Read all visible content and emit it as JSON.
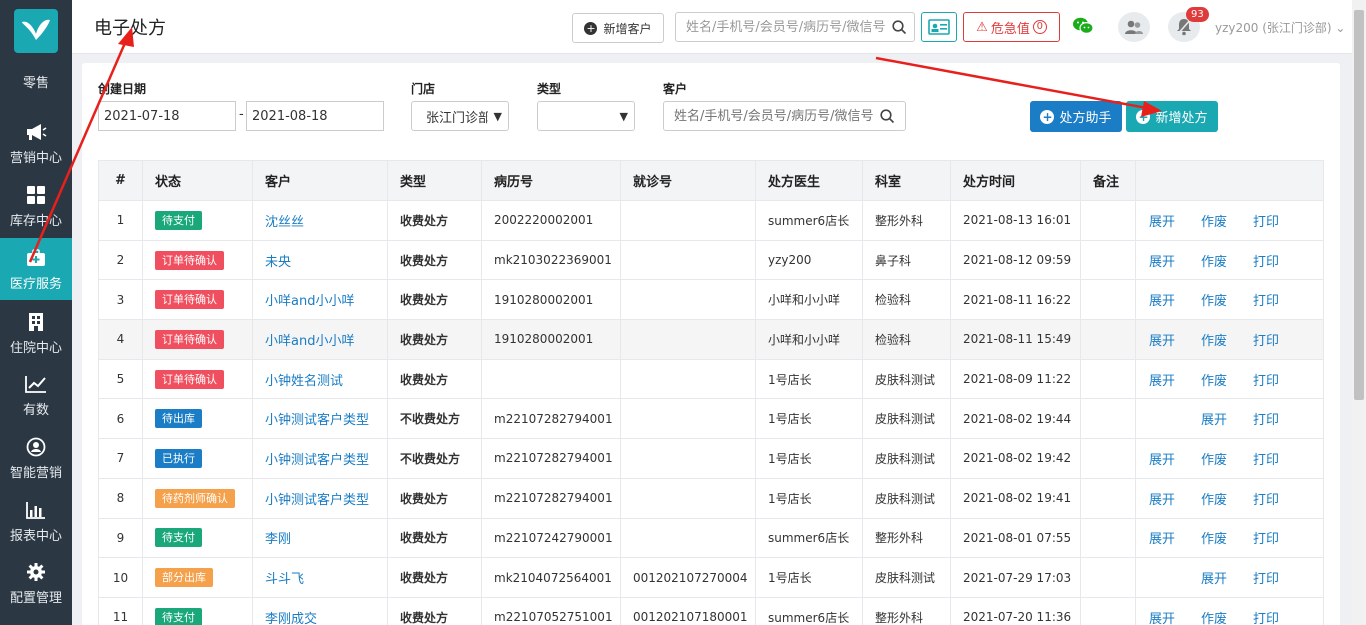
{
  "sidebar": {
    "items": [
      {
        "label": "零售",
        "icon": "retail-icon"
      },
      {
        "label": "营销中心",
        "icon": "megaphone-icon"
      },
      {
        "label": "库存中心",
        "icon": "grid-icon"
      },
      {
        "label": "医疗服务",
        "icon": "medical-kit-icon",
        "active": true
      },
      {
        "label": "住院中心",
        "icon": "building-icon"
      },
      {
        "label": "有数",
        "icon": "trend-icon"
      },
      {
        "label": "智能营销",
        "icon": "ai-icon"
      },
      {
        "label": "报表中心",
        "icon": "bar-chart-icon"
      },
      {
        "label": "配置管理",
        "icon": "gear-icon"
      }
    ]
  },
  "header": {
    "title": "电子处方",
    "new_customer": "新增客户",
    "search_placeholder": "姓名/手机号/会员号/病历号/微信号",
    "urgent_label": "危急值",
    "urgent_count": "0",
    "notify_count": "93",
    "user": "yzy200 (张江门诊部)"
  },
  "filters": {
    "date_label": "创建日期",
    "date_from": "2021-07-18",
    "date_sep": "-",
    "date_to": "2021-08-18",
    "store_label": "门店",
    "store_value": "张江门诊部",
    "type_label": "类型",
    "type_value": "",
    "customer_label": "客户",
    "customer_placeholder": "姓名/手机号/会员号/病历号/微信号",
    "assistant_button": "处方助手",
    "new_rx_button": "新增处方"
  },
  "table": {
    "headers": [
      "#",
      "状态",
      "客户",
      "类型",
      "病历号",
      "就诊号",
      "处方医生",
      "科室",
      "处方时间",
      "备注"
    ],
    "rows": [
      {
        "idx": "1",
        "status": "待支付",
        "status_color": "#1aa87a",
        "customer": "沈丝丝",
        "type": "收费处方",
        "record": "2002220002001",
        "visit": "",
        "doctor": "summer6店长",
        "dept": "整形外科",
        "time": "2021-08-13 16:01",
        "note": "",
        "actions": [
          "展开",
          "作废",
          "打印"
        ]
      },
      {
        "idx": "2",
        "status": "订单待确认",
        "status_color": "#ef4f5f",
        "customer": "未央",
        "type": "收费处方",
        "record": "mk2103022369001",
        "visit": "",
        "doctor": "yzy200",
        "dept": "鼻子科",
        "time": "2021-08-12 09:59",
        "note": "",
        "actions": [
          "展开",
          "作废",
          "打印"
        ]
      },
      {
        "idx": "3",
        "status": "订单待确认",
        "status_color": "#ef4f5f",
        "customer": "小咩and小小咩",
        "type": "收费处方",
        "record": "1910280002001",
        "visit": "",
        "doctor": "小咩和小小咩",
        "dept": "检验科",
        "time": "2021-08-11 16:22",
        "note": "",
        "actions": [
          "展开",
          "作废",
          "打印"
        ]
      },
      {
        "idx": "4",
        "status": "订单待确认",
        "status_color": "#ef4f5f",
        "customer": "小咩and小小咩",
        "type": "收费处方",
        "record": "1910280002001",
        "visit": "",
        "doctor": "小咩和小小咩",
        "dept": "检验科",
        "time": "2021-08-11 15:49",
        "note": "",
        "actions": [
          "展开",
          "作废",
          "打印"
        ]
      },
      {
        "idx": "5",
        "status": "订单待确认",
        "status_color": "#ef4f5f",
        "customer": "小钟姓名测试",
        "type": "收费处方",
        "record": "",
        "visit": "",
        "doctor": "1号店长",
        "dept": "皮肤科测试",
        "time": "2021-08-09 11:22",
        "note": "",
        "actions": [
          "展开",
          "作废",
          "打印"
        ]
      },
      {
        "idx": "6",
        "status": "待出库",
        "status_color": "#1a7dc5",
        "customer": "小钟测试客户类型",
        "type": "不收费处方",
        "record": "m22107282794001",
        "visit": "",
        "doctor": "1号店长",
        "dept": "皮肤科测试",
        "time": "2021-08-02 19:44",
        "note": "",
        "actions": [
          "",
          "展开",
          "打印"
        ]
      },
      {
        "idx": "7",
        "status": "已执行",
        "status_color": "#1a7dc5",
        "customer": "小钟测试客户类型",
        "type": "不收费处方",
        "record": "m22107282794001",
        "visit": "",
        "doctor": "1号店长",
        "dept": "皮肤科测试",
        "time": "2021-08-02 19:42",
        "note": "",
        "actions": [
          "展开",
          "作废",
          "打印"
        ]
      },
      {
        "idx": "8",
        "status": "待药剂师确认",
        "status_color": "#f5a04a",
        "customer": "小钟测试客户类型",
        "type": "收费处方",
        "record": "m22107282794001",
        "visit": "",
        "doctor": "1号店长",
        "dept": "皮肤科测试",
        "time": "2021-08-02 19:41",
        "note": "",
        "actions": [
          "展开",
          "作废",
          "打印"
        ]
      },
      {
        "idx": "9",
        "status": "待支付",
        "status_color": "#1aa87a",
        "customer": "李刚",
        "type": "收费处方",
        "record": "m22107242790001",
        "visit": "",
        "doctor": "summer6店长",
        "dept": "整形外科",
        "time": "2021-08-01 07:55",
        "note": "",
        "actions": [
          "展开",
          "作废",
          "打印"
        ]
      },
      {
        "idx": "10",
        "status": "部分出库",
        "status_color": "#f5a04a",
        "customer": "斗斗飞",
        "type": "收费处方",
        "record": "mk2104072564001",
        "visit": "001202107270004",
        "doctor": "1号店长",
        "dept": "皮肤科测试",
        "time": "2021-07-29 17:03",
        "note": "",
        "actions": [
          "",
          "展开",
          "打印"
        ]
      },
      {
        "idx": "11",
        "status": "待支付",
        "status_color": "#1aa87a",
        "customer": "李刚成交",
        "type": "收费处方",
        "record": "m22107052751001",
        "visit": "001202107180001",
        "doctor": "summer6店长",
        "dept": "整形外科",
        "time": "2021-07-20 11:36",
        "note": "",
        "actions": [
          "展开",
          "作废",
          "打印"
        ]
      }
    ]
  }
}
